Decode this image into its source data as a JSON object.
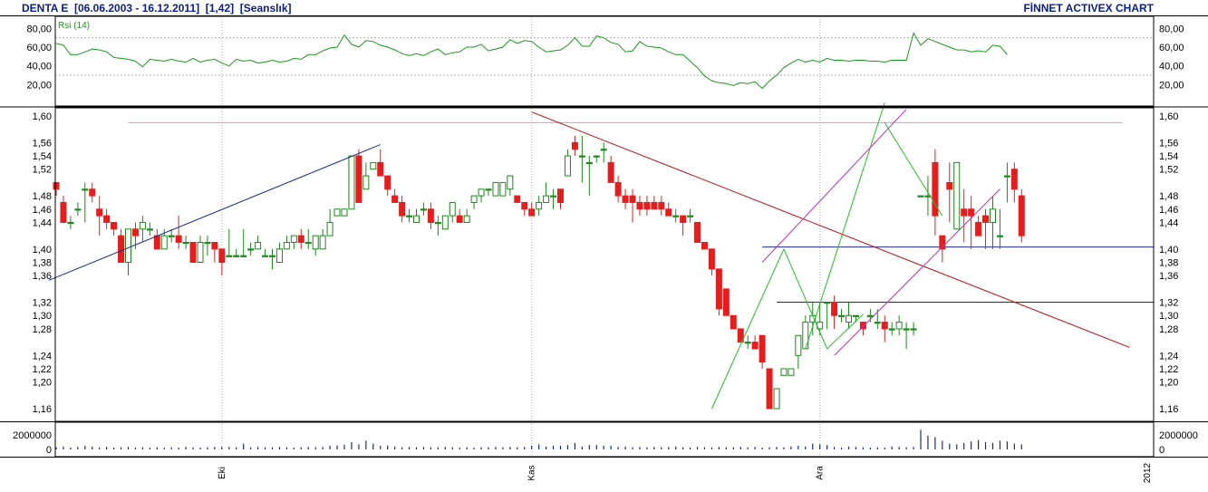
{
  "header": {
    "title": "DENTA E  [06.06.2003 - 16.12.2011]  [1,42]  [Seanslık]",
    "brand": "FİNNET ACTIVEX CHART"
  },
  "colors": {
    "frame": "#000000",
    "grid": "#b0b0b0",
    "rsi_line": "#1a9a1a",
    "bull_candle": "#1a8a1a",
    "bear_candle": "#e31e1e",
    "volume": "#1e2a8c",
    "trend_blue": "#1e2a8c",
    "trend_red": "#c0101a",
    "trend_pink": "#e890a0",
    "trend_green": "#22c022",
    "channel_magenta": "#c030c0",
    "header_text": "#0a1e8c"
  },
  "chart_data": [
    {
      "type": "line",
      "title": "Rsi (14)",
      "y_ticks": [
        "80,00",
        "60,00",
        "40,00",
        "20,00"
      ],
      "ylim": [
        0,
        90
      ],
      "dashed_levels": [
        70,
        30
      ],
      "series": [
        {
          "name": "Rsi (14)",
          "values": [
            64,
            62,
            52,
            52,
            55,
            58,
            57,
            55,
            49,
            48,
            47,
            45,
            39,
            47,
            46,
            45,
            47,
            45,
            44,
            48,
            44,
            46,
            47,
            43,
            40,
            47,
            45,
            46,
            43,
            44,
            46,
            44,
            45,
            48,
            47,
            52,
            52,
            56,
            59,
            60,
            73,
            63,
            60,
            67,
            66,
            62,
            60,
            57,
            53,
            51,
            53,
            51,
            55,
            58,
            52,
            54,
            55,
            60,
            60,
            63,
            56,
            58,
            60,
            68,
            64,
            67,
            66,
            60,
            55,
            56,
            57,
            62,
            70,
            61,
            61,
            72,
            70,
            65,
            63,
            55,
            56,
            66,
            61,
            60,
            59,
            55,
            52,
            52,
            45,
            38,
            29,
            24,
            22,
            21,
            19,
            22,
            21,
            23,
            16,
            24,
            30,
            38,
            43,
            47,
            44,
            46,
            44,
            48,
            46,
            46,
            45,
            46,
            46,
            45,
            45,
            44,
            46,
            46,
            46,
            75,
            62,
            69,
            66,
            63,
            60,
            57,
            57,
            55,
            56,
            55,
            62,
            61,
            52
          ]
        }
      ]
    },
    {
      "type": "candlestick",
      "y_ticks": [
        "1,60",
        "1,56",
        "1,54",
        "1,52",
        "1,48",
        "1,46",
        "1,44",
        "1,40",
        "1,38",
        "1,36",
        "1,32",
        "1,30",
        "1,28",
        "1,24",
        "1,22",
        "1,20",
        "1,16"
      ],
      "ylim": [
        1.14,
        1.61
      ],
      "x_labels": [
        "Eki",
        "Kas",
        "Ara",
        "2012"
      ],
      "x_label_index": [
        23,
        66,
        106,
        150
      ],
      "candles": [
        [
          1.5,
          1.5,
          1.48,
          1.49
        ],
        [
          1.47,
          1.48,
          1.44,
          1.44
        ],
        [
          1.44,
          1.45,
          1.43,
          1.44
        ],
        [
          1.46,
          1.47,
          1.45,
          1.46
        ],
        [
          1.49,
          1.5,
          1.44,
          1.49
        ],
        [
          1.49,
          1.5,
          1.47,
          1.48
        ],
        [
          1.46,
          1.48,
          1.42,
          1.45
        ],
        [
          1.45,
          1.46,
          1.43,
          1.44
        ],
        [
          1.44,
          1.44,
          1.42,
          1.43
        ],
        [
          1.42,
          1.43,
          1.38,
          1.38
        ],
        [
          1.38,
          1.43,
          1.36,
          1.43
        ],
        [
          1.43,
          1.44,
          1.4,
          1.42
        ],
        [
          1.43,
          1.45,
          1.41,
          1.44
        ],
        [
          1.43,
          1.44,
          1.42,
          1.43
        ],
        [
          1.42,
          1.43,
          1.4,
          1.4
        ],
        [
          1.4,
          1.43,
          1.4,
          1.42
        ],
        [
          1.42,
          1.43,
          1.41,
          1.42
        ],
        [
          1.42,
          1.45,
          1.4,
          1.41
        ],
        [
          1.41,
          1.42,
          1.4,
          1.41
        ],
        [
          1.41,
          1.41,
          1.38,
          1.38
        ],
        [
          1.38,
          1.42,
          1.38,
          1.41
        ],
        [
          1.41,
          1.42,
          1.39,
          1.41
        ],
        [
          1.41,
          1.41,
          1.38,
          1.4
        ],
        [
          1.4,
          1.4,
          1.36,
          1.38
        ],
        [
          1.39,
          1.43,
          1.39,
          1.39
        ],
        [
          1.39,
          1.4,
          1.39,
          1.39
        ],
        [
          1.39,
          1.43,
          1.39,
          1.39
        ],
        [
          1.4,
          1.41,
          1.39,
          1.4
        ],
        [
          1.4,
          1.42,
          1.4,
          1.41
        ],
        [
          1.39,
          1.4,
          1.39,
          1.39
        ],
        [
          1.39,
          1.4,
          1.37,
          1.39
        ],
        [
          1.38,
          1.41,
          1.38,
          1.4
        ],
        [
          1.4,
          1.42,
          1.4,
          1.41
        ],
        [
          1.41,
          1.42,
          1.4,
          1.42
        ],
        [
          1.42,
          1.43,
          1.4,
          1.41
        ],
        [
          1.41,
          1.43,
          1.4,
          1.41
        ],
        [
          1.4,
          1.42,
          1.39,
          1.42
        ],
        [
          1.4,
          1.43,
          1.4,
          1.42
        ],
        [
          1.42,
          1.46,
          1.42,
          1.44
        ],
        [
          1.45,
          1.46,
          1.45,
          1.46
        ],
        [
          1.45,
          1.46,
          1.45,
          1.46
        ],
        [
          1.46,
          1.54,
          1.46,
          1.54
        ],
        [
          1.54,
          1.55,
          1.47,
          1.47
        ],
        [
          1.49,
          1.53,
          1.49,
          1.51
        ],
        [
          1.52,
          1.53,
          1.52,
          1.53
        ],
        [
          1.53,
          1.55,
          1.51,
          1.51
        ],
        [
          1.51,
          1.51,
          1.48,
          1.49
        ],
        [
          1.48,
          1.49,
          1.47,
          1.47
        ],
        [
          1.47,
          1.48,
          1.44,
          1.45
        ],
        [
          1.45,
          1.46,
          1.44,
          1.45
        ],
        [
          1.44,
          1.46,
          1.44,
          1.45
        ],
        [
          1.46,
          1.47,
          1.45,
          1.46
        ],
        [
          1.46,
          1.47,
          1.43,
          1.44
        ],
        [
          1.44,
          1.45,
          1.42,
          1.44
        ],
        [
          1.43,
          1.45,
          1.43,
          1.45
        ],
        [
          1.45,
          1.47,
          1.44,
          1.47
        ],
        [
          1.45,
          1.46,
          1.44,
          1.44
        ],
        [
          1.44,
          1.46,
          1.44,
          1.45
        ],
        [
          1.47,
          1.48,
          1.46,
          1.48
        ],
        [
          1.48,
          1.49,
          1.47,
          1.49
        ],
        [
          1.49,
          1.49,
          1.48,
          1.49
        ],
        [
          1.48,
          1.5,
          1.48,
          1.5
        ],
        [
          1.48,
          1.5,
          1.48,
          1.5
        ],
        [
          1.49,
          1.51,
          1.48,
          1.51
        ],
        [
          1.48,
          1.48,
          1.47,
          1.47
        ],
        [
          1.47,
          1.47,
          1.45,
          1.46
        ],
        [
          1.46,
          1.47,
          1.45,
          1.45
        ],
        [
          1.46,
          1.48,
          1.45,
          1.47
        ],
        [
          1.47,
          1.5,
          1.47,
          1.48
        ],
        [
          1.48,
          1.49,
          1.46,
          1.48
        ],
        [
          1.49,
          1.49,
          1.46,
          1.47
        ],
        [
          1.51,
          1.55,
          1.51,
          1.54
        ],
        [
          1.56,
          1.57,
          1.54,
          1.55
        ],
        [
          1.54,
          1.57,
          1.5,
          1.54
        ],
        [
          1.53,
          1.54,
          1.48,
          1.53
        ],
        [
          1.54,
          1.54,
          1.53,
          1.54
        ],
        [
          1.55,
          1.56,
          1.53,
          1.55
        ],
        [
          1.53,
          1.54,
          1.5,
          1.5
        ],
        [
          1.5,
          1.51,
          1.47,
          1.48
        ],
        [
          1.48,
          1.49,
          1.46,
          1.47
        ],
        [
          1.48,
          1.49,
          1.44,
          1.47
        ],
        [
          1.47,
          1.48,
          1.45,
          1.46
        ],
        [
          1.47,
          1.48,
          1.45,
          1.46
        ],
        [
          1.47,
          1.48,
          1.46,
          1.46
        ],
        [
          1.47,
          1.48,
          1.45,
          1.46
        ],
        [
          1.46,
          1.47,
          1.45,
          1.45
        ],
        [
          1.45,
          1.46,
          1.44,
          1.45
        ],
        [
          1.45,
          1.45,
          1.42,
          1.44
        ],
        [
          1.45,
          1.46,
          1.44,
          1.45
        ],
        [
          1.44,
          1.44,
          1.41,
          1.41
        ],
        [
          1.41,
          1.41,
          1.4,
          1.4
        ],
        [
          1.4,
          1.4,
          1.36,
          1.37
        ],
        [
          1.37,
          1.37,
          1.3,
          1.31
        ],
        [
          1.34,
          1.34,
          1.3,
          1.3
        ],
        [
          1.3,
          1.3,
          1.28,
          1.28
        ],
        [
          1.28,
          1.28,
          1.26,
          1.26
        ],
        [
          1.26,
          1.27,
          1.25,
          1.26
        ],
        [
          1.26,
          1.27,
          1.25,
          1.25
        ],
        [
          1.27,
          1.27,
          1.22,
          1.23
        ],
        [
          1.22,
          1.22,
          1.16,
          1.16
        ],
        [
          1.16,
          1.19,
          1.16,
          1.19
        ],
        [
          1.21,
          1.22,
          1.21,
          1.22
        ],
        [
          1.21,
          1.22,
          1.21,
          1.22
        ],
        [
          1.24,
          1.27,
          1.22,
          1.27
        ],
        [
          1.25,
          1.3,
          1.25,
          1.29
        ],
        [
          1.29,
          1.32,
          1.27,
          1.3
        ],
        [
          1.28,
          1.32,
          1.27,
          1.29
        ],
        [
          1.32,
          1.32,
          1.28,
          1.32
        ],
        [
          1.32,
          1.33,
          1.28,
          1.3
        ],
        [
          1.3,
          1.31,
          1.29,
          1.3
        ],
        [
          1.29,
          1.32,
          1.28,
          1.3
        ],
        [
          1.3,
          1.3,
          1.29,
          1.3
        ],
        [
          1.29,
          1.29,
          1.27,
          1.28
        ],
        [
          1.3,
          1.31,
          1.29,
          1.3
        ],
        [
          1.29,
          1.31,
          1.28,
          1.29
        ],
        [
          1.29,
          1.3,
          1.26,
          1.28
        ],
        [
          1.28,
          1.29,
          1.27,
          1.28
        ],
        [
          1.28,
          1.3,
          1.27,
          1.29
        ],
        [
          1.28,
          1.29,
          1.25,
          1.28
        ],
        [
          1.28,
          1.29,
          1.27,
          1.28
        ],
        [
          1.48,
          1.48,
          1.48,
          1.48
        ],
        [
          1.48,
          1.51,
          1.45,
          1.48
        ],
        [
          1.53,
          1.55,
          1.42,
          1.45
        ],
        [
          1.42,
          1.42,
          1.38,
          1.4
        ],
        [
          1.5,
          1.53,
          1.44,
          1.49
        ],
        [
          1.43,
          1.53,
          1.43,
          1.53
        ],
        [
          1.46,
          1.49,
          1.41,
          1.45
        ],
        [
          1.46,
          1.48,
          1.4,
          1.45
        ],
        [
          1.44,
          1.45,
          1.42,
          1.42
        ],
        [
          1.45,
          1.46,
          1.4,
          1.44
        ],
        [
          1.44,
          1.48,
          1.4,
          1.46
        ],
        [
          1.42,
          1.46,
          1.4,
          1.42
        ],
        [
          1.51,
          1.53,
          1.47,
          1.51
        ],
        [
          1.52,
          1.53,
          1.47,
          1.49
        ],
        [
          1.48,
          1.49,
          1.41,
          1.42
        ]
      ],
      "horizontal_levels": [
        {
          "y": 1.59,
          "from": 10,
          "to": 148,
          "color": "pink"
        },
        {
          "y": 1.403,
          "from": 98,
          "to": 150,
          "color": "blue"
        },
        {
          "y": 1.32,
          "from": 100,
          "to": 150,
          "color": "blue"
        }
      ],
      "trend_lines": [
        {
          "from": [
            -1,
            1.353
          ],
          "to": [
            45,
            1.557
          ],
          "color": "blue"
        },
        {
          "from": [
            66,
            1.606
          ],
          "to": [
            149,
            1.252
          ],
          "color": "red"
        },
        {
          "from": [
            91,
            1.16
          ],
          "to": [
            101,
            1.4
          ],
          "color": "green"
        },
        {
          "from": [
            101,
            1.4
          ],
          "to": [
            107,
            1.25
          ],
          "color": "green"
        },
        {
          "from": [
            107,
            1.25
          ],
          "to": [
            112,
            1.302
          ],
          "color": "green"
        },
        {
          "from": [
            104,
            1.25
          ],
          "to": [
            115,
            1.62
          ],
          "color": "green"
        },
        {
          "from": [
            115,
            1.59
          ],
          "to": [
            123,
            1.45
          ],
          "color": "green"
        },
        {
          "from": [
            98,
            1.38
          ],
          "to": [
            118,
            1.61
          ],
          "color": "magenta"
        },
        {
          "from": [
            108,
            1.24
          ],
          "to": [
            131,
            1.49
          ],
          "color": "magenta"
        }
      ]
    },
    {
      "type": "bar",
      "y_ticks": [
        "2000000",
        "0"
      ],
      "ylim": [
        0,
        3000000
      ],
      "values": [
        300000,
        400000,
        250000,
        350000,
        500000,
        400000,
        300000,
        350000,
        250000,
        300000,
        350000,
        250000,
        300000,
        250000,
        300000,
        250000,
        300000,
        250000,
        350000,
        300000,
        250000,
        300000,
        350000,
        350000,
        350000,
        300000,
        800000,
        300000,
        350000,
        300000,
        300000,
        350000,
        300000,
        250000,
        300000,
        350000,
        300000,
        350000,
        500000,
        550000,
        650000,
        1000000,
        700000,
        1200000,
        800000,
        500000,
        550000,
        400000,
        300000,
        350000,
        300000,
        350000,
        300000,
        300000,
        350000,
        300000,
        250000,
        300000,
        250000,
        300000,
        300000,
        350000,
        300000,
        350000,
        300000,
        350000,
        500000,
        700000,
        400000,
        500000,
        500000,
        600000,
        900000,
        400000,
        600000,
        600000,
        500000,
        500000,
        350000,
        400000,
        300000,
        350000,
        300000,
        350000,
        300000,
        350000,
        400000,
        300000,
        250000,
        350000,
        300000,
        250000,
        350000,
        300000,
        300000,
        350000,
        300000,
        350000,
        250000,
        300000,
        350000,
        300000,
        400000,
        500000,
        400000,
        800000,
        700000,
        600000,
        350000,
        250000,
        400000,
        350000,
        300000,
        250000,
        300000,
        250000,
        400000,
        350000,
        300000,
        350000,
        2700000,
        1900000,
        1700000,
        1200000,
        800000,
        700000,
        900000,
        1100000,
        1300000,
        1000000,
        900000,
        1200000,
        1100000,
        800000,
        700000
      ]
    }
  ]
}
